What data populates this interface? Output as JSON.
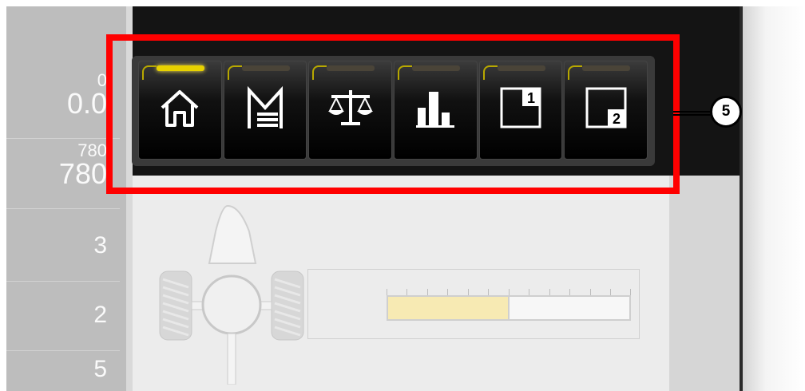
{
  "left_panel": {
    "rows": [
      {
        "small": "0",
        "big": "0.0"
      },
      {
        "small": "780",
        "big": "780"
      }
    ],
    "numbers": [
      "3",
      "2",
      "5"
    ]
  },
  "toolbar": {
    "buttons": [
      {
        "name": "home",
        "icon": "home-icon",
        "led_on": true
      },
      {
        "name": "menu",
        "icon": "menu-m-icon",
        "led_on": false
      },
      {
        "name": "scale",
        "icon": "scale-icon",
        "led_on": false
      },
      {
        "name": "statistics",
        "icon": "bar-chart-icon",
        "led_on": false
      },
      {
        "name": "screen-1",
        "icon": "screen-1-icon",
        "badge": "1",
        "led_on": false
      },
      {
        "name": "screen-2",
        "icon": "screen-2-icon",
        "badge": "2",
        "led_on": false
      }
    ]
  },
  "callout": {
    "label": "5"
  },
  "gauge": {
    "level": 0.5
  },
  "colors": {
    "highlight": "#ff0000",
    "led_on": "#e8d200",
    "gauge_fill": "#f7eab3"
  }
}
